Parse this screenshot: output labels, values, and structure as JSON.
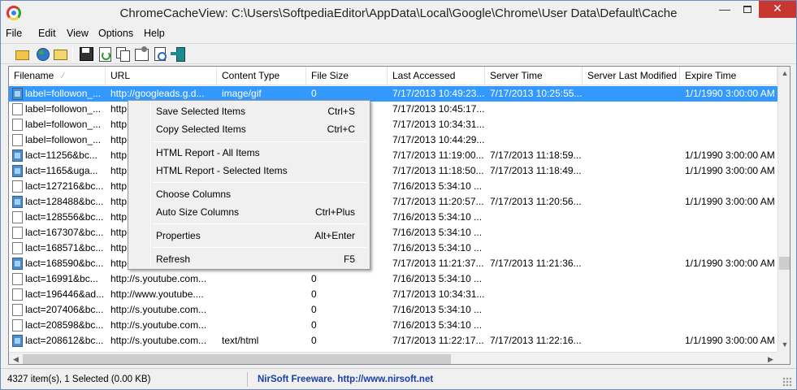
{
  "window": {
    "title": "ChromeCacheView:  C:\\Users\\SoftpediaEditor\\AppData\\Local\\Google\\Chrome\\User Data\\Default\\Cache",
    "minimize_glyph": "—",
    "close_glyph": "✕"
  },
  "menu": [
    "File",
    "Edit",
    "View",
    "Options",
    "Help"
  ],
  "toolbar": {
    "icons": [
      "open-folder-icon",
      "globe-icon",
      "folder-icon",
      "save-icon",
      "refresh-icon",
      "copy-icon",
      "properties-icon",
      "find-icon",
      "exit-icon"
    ]
  },
  "columns": [
    "Filename",
    "URL",
    "Content Type",
    "File Size",
    "Last Accessed",
    "Server Time",
    "Server Last Modified",
    "Expire Time"
  ],
  "rows": [
    {
      "icon": "pic",
      "filename": "label=followon_...",
      "url": "http://googleads.g.d...",
      "type": "image/gif",
      "size": "0",
      "accessed": "7/17/2013 10:49:23...",
      "server_time": "7/17/2013 10:25:55...",
      "server_modified": "",
      "expire": "1/1/1990 3:00:00 AM",
      "selected": true
    },
    {
      "icon": "doc",
      "filename": "label=followon_...",
      "url": "http",
      "type": "",
      "size": "",
      "accessed": "7/17/2013 10:45:17...",
      "server_time": "",
      "server_modified": "",
      "expire": ""
    },
    {
      "icon": "doc",
      "filename": "label=followon_...",
      "url": "http",
      "type": "",
      "size": "",
      "accessed": "7/17/2013 10:34:31...",
      "server_time": "",
      "server_modified": "",
      "expire": ""
    },
    {
      "icon": "doc",
      "filename": "label=followon_...",
      "url": "http",
      "type": "",
      "size": "",
      "accessed": "7/17/2013 10:44:29...",
      "server_time": "",
      "server_modified": "",
      "expire": ""
    },
    {
      "icon": "pic",
      "filename": "lact=11256&bc...",
      "url": "http",
      "type": "",
      "size": "",
      "accessed": "7/17/2013 11:19:00...",
      "server_time": "7/17/2013 11:18:59...",
      "server_modified": "",
      "expire": "1/1/1990 3:00:00 AM"
    },
    {
      "icon": "pic",
      "filename": "lact=1165&uga...",
      "url": "http",
      "type": "",
      "size": "",
      "accessed": "7/17/2013 11:18:50...",
      "server_time": "7/17/2013 11:18:49...",
      "server_modified": "",
      "expire": "1/1/1990 3:00:00 AM"
    },
    {
      "icon": "doc",
      "filename": "lact=127216&bc...",
      "url": "http",
      "type": "",
      "size": "",
      "accessed": "7/16/2013 5:34:10 ...",
      "server_time": "",
      "server_modified": "",
      "expire": ""
    },
    {
      "icon": "pic",
      "filename": "lact=128488&bc...",
      "url": "http",
      "type": "",
      "size": "",
      "accessed": "7/17/2013 11:20:57...",
      "server_time": "7/17/2013 11:20:56...",
      "server_modified": "",
      "expire": "1/1/1990 3:00:00 AM"
    },
    {
      "icon": "doc",
      "filename": "lact=128556&bc...",
      "url": "http",
      "type": "",
      "size": "",
      "accessed": "7/16/2013 5:34:10 ...",
      "server_time": "",
      "server_modified": "",
      "expire": ""
    },
    {
      "icon": "doc",
      "filename": "lact=167307&bc...",
      "url": "http",
      "type": "",
      "size": "",
      "accessed": "7/16/2013 5:34:10 ...",
      "server_time": "",
      "server_modified": "",
      "expire": ""
    },
    {
      "icon": "doc",
      "filename": "lact=168571&bc...",
      "url": "http",
      "type": "",
      "size": "",
      "accessed": "7/16/2013 5:34:10 ...",
      "server_time": "",
      "server_modified": "",
      "expire": ""
    },
    {
      "icon": "pic",
      "filename": "lact=168590&bc...",
      "url": "http",
      "type": "",
      "size": "",
      "accessed": "7/17/2013 11:21:37...",
      "server_time": "7/17/2013 11:21:36...",
      "server_modified": "",
      "expire": "1/1/1990 3:00:00 AM"
    },
    {
      "icon": "doc",
      "filename": "lact=16991&bc...",
      "url": "http://s.youtube.com...",
      "type": "",
      "size": "0",
      "accessed": "7/16/2013 5:34:10 ...",
      "server_time": "",
      "server_modified": "",
      "expire": ""
    },
    {
      "icon": "doc",
      "filename": "lact=196446&ad...",
      "url": "http://www.youtube....",
      "type": "",
      "size": "0",
      "accessed": "7/17/2013 10:34:31...",
      "server_time": "",
      "server_modified": "",
      "expire": ""
    },
    {
      "icon": "doc",
      "filename": "lact=207406&bc...",
      "url": "http://s.youtube.com...",
      "type": "",
      "size": "0",
      "accessed": "7/16/2013 5:34:10 ...",
      "server_time": "",
      "server_modified": "",
      "expire": ""
    },
    {
      "icon": "doc",
      "filename": "lact=208598&bc...",
      "url": "http://s.youtube.com...",
      "type": "",
      "size": "0",
      "accessed": "7/16/2013 5:34:10 ...",
      "server_time": "",
      "server_modified": "",
      "expire": ""
    },
    {
      "icon": "pic",
      "filename": "lact=208612&bc...",
      "url": "http://s.youtube.com...",
      "type": "text/html",
      "size": "0",
      "accessed": "7/17/2013 11:22:17...",
      "server_time": "7/17/2013 11:22:16...",
      "server_modified": "",
      "expire": "1/1/1990 3:00:00 AM"
    }
  ],
  "context_menu": {
    "groups": [
      [
        {
          "label": "Save Selected Items",
          "shortcut": "Ctrl+S"
        },
        {
          "label": "Copy Selected Items",
          "shortcut": "Ctrl+C"
        }
      ],
      [
        {
          "label": "HTML Report - All Items",
          "shortcut": ""
        },
        {
          "label": "HTML Report - Selected Items",
          "shortcut": ""
        }
      ],
      [
        {
          "label": "Choose Columns",
          "shortcut": ""
        },
        {
          "label": "Auto Size Columns",
          "shortcut": "Ctrl+Plus"
        }
      ],
      [
        {
          "label": "Properties",
          "shortcut": "Alt+Enter"
        }
      ],
      [
        {
          "label": "Refresh",
          "shortcut": "F5"
        }
      ]
    ]
  },
  "status": {
    "count_text": "4327 item(s), 1 Selected  (0.00 KB)",
    "link_text": "NirSoft Freeware.  http://www.nirsoft.net"
  },
  "colors": {
    "selection": "#3399ff",
    "link": "#1a3ea8",
    "close_button": "#c7372f"
  }
}
